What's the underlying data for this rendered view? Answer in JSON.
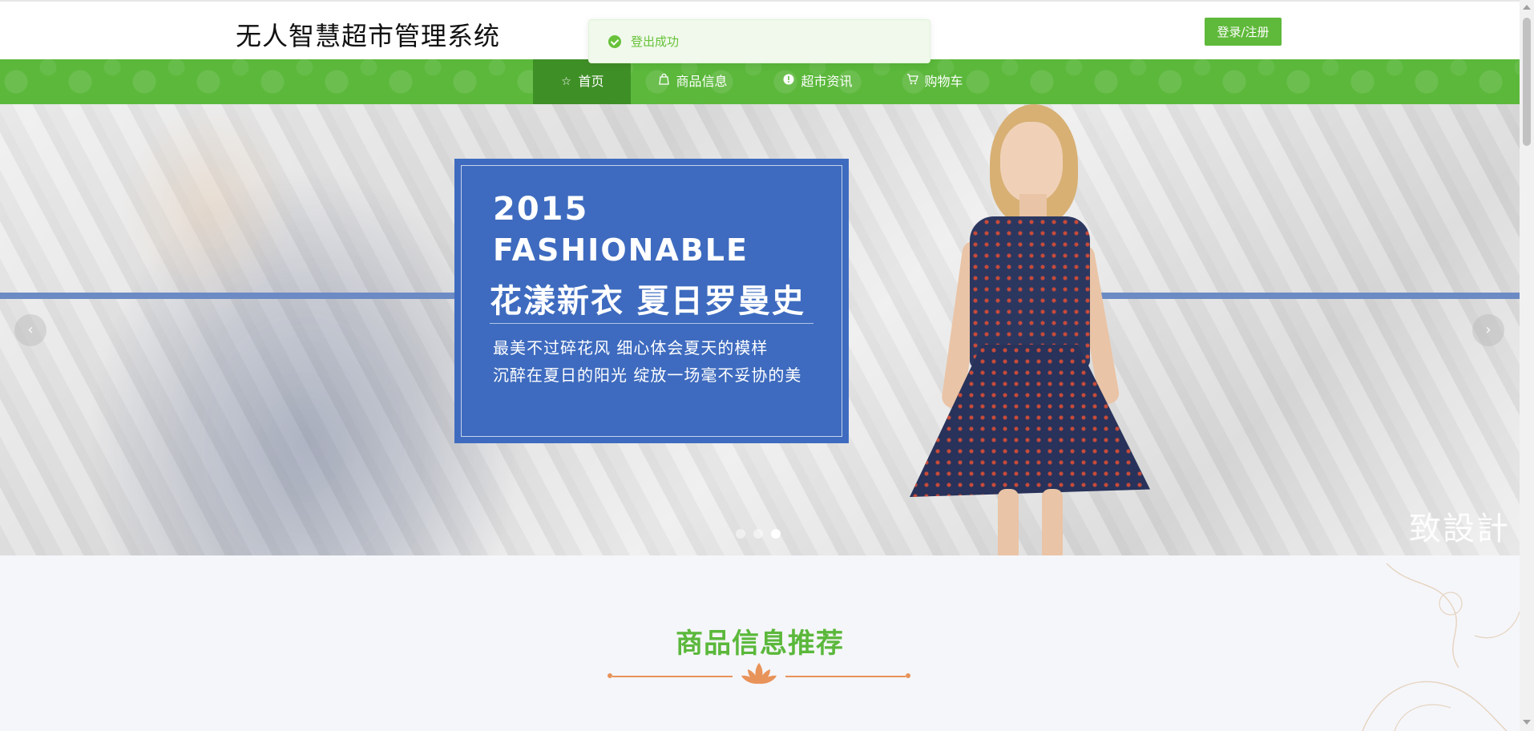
{
  "header": {
    "site_title": "无人智慧超市管理系统",
    "login_label": "登录/注册"
  },
  "toast": {
    "message": "登出成功",
    "icon": "check-circle-icon",
    "color": "#67c23a"
  },
  "nav": {
    "items": [
      {
        "label": "首页",
        "icon": "star-icon",
        "active": true
      },
      {
        "label": "商品信息",
        "icon": "bag-icon",
        "active": false
      },
      {
        "label": "超市资讯",
        "icon": "info-icon",
        "active": false
      },
      {
        "label": "购物车",
        "icon": "cart-icon",
        "active": false
      }
    ]
  },
  "banner": {
    "year": "2015",
    "headline_en": "FASHIONABLE",
    "headline_cn": "花漾新衣  夏日罗曼史",
    "subtitle_1": "最美不过碎花风 细心体会夏天的模样",
    "subtitle_2": "沉醉在夏日的阳光 绽放一场毫不妥协的美",
    "watermark": "致設計",
    "active_slide": 3,
    "slide_count": 3
  },
  "section": {
    "title": "商品信息推荐"
  },
  "colors": {
    "brand_green": "#5bb83b",
    "nav_active": "#3f8f27",
    "promo_blue": "#3e6bbf",
    "ornament_orange": "#e8935a"
  }
}
